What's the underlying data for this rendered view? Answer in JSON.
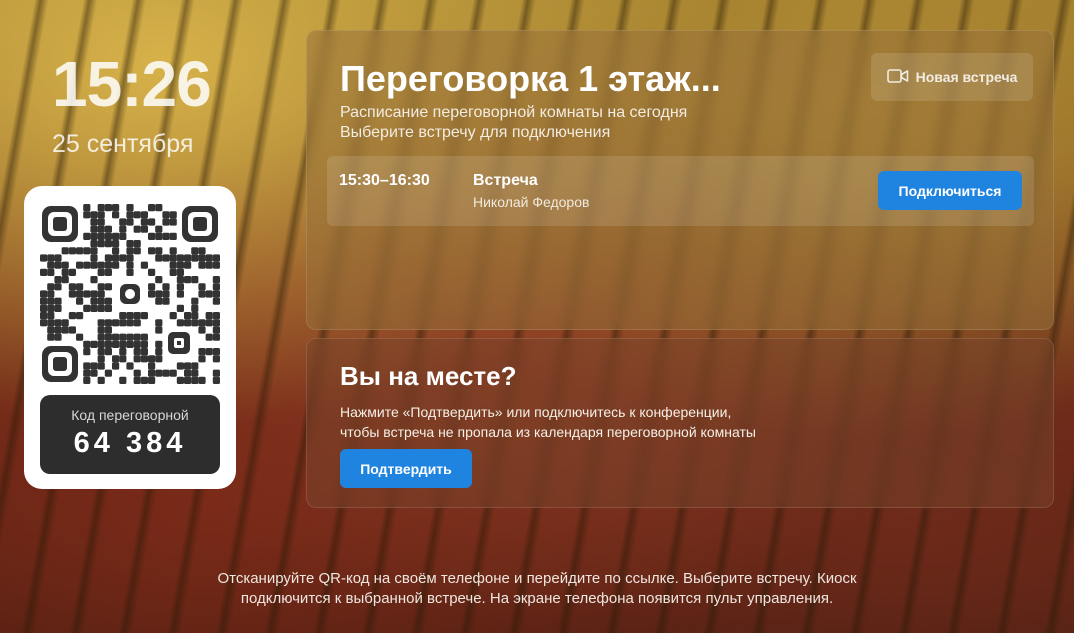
{
  "clock": {
    "time": "15:26",
    "date": "25 сентября"
  },
  "qr_card": {
    "code_label": "Код переговорной",
    "code_value": "64 384"
  },
  "room_panel": {
    "title": "Переговорка 1 этаж...",
    "subtitle_line1": "Расписание переговорной комнаты на сегодня",
    "subtitle_line2": "Выберите встречу для подключения",
    "new_meeting_label": "Новая встреча",
    "new_meeting_icon": "video-camera-icon",
    "meetings": [
      {
        "time": "15:30–16:30",
        "title": "Встреча",
        "owner": "Николай Федоров",
        "action_label": "Подключиться"
      }
    ]
  },
  "presence_panel": {
    "title": "Вы на месте?",
    "text_line1": "Нажмите «Подтвердить» или подключитесь к конференции,",
    "text_line2": "чтобы встреча не пропала из календаря переговорной комнаты",
    "confirm_label": "Подтвердить"
  },
  "footer": {
    "line1": "Отсканируйте QR-код на своём телефоне и перейдите по ссылке. Выберите встречу. Киоск",
    "line2": "подключится к выбранной встрече. На экране телефона появится пульт управления."
  },
  "colors": {
    "accent_button": "#1f84e0",
    "code_box": "#2d2d2d",
    "qr_module": "#333333"
  }
}
